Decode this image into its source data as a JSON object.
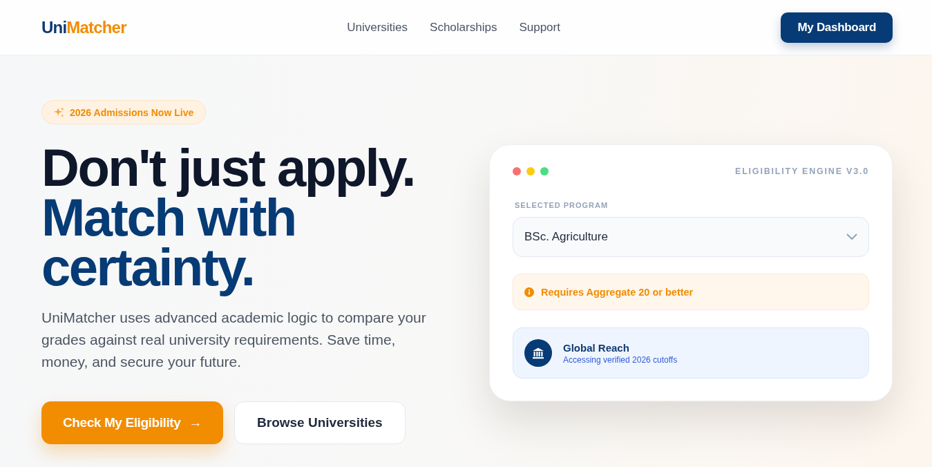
{
  "header": {
    "logo": [
      {
        "text": "Uni",
        "kind": "primary"
      },
      {
        "text": "Matcher",
        "kind": "accent"
      }
    ],
    "nav": [
      {
        "label": "Universities"
      },
      {
        "label": "Scholarships"
      },
      {
        "label": "Support"
      }
    ],
    "dashboard_button": "My Dashboard"
  },
  "hero": {
    "badge": "2026 Admissions Now Live",
    "headline": [
      {
        "text": "Don't just apply.",
        "kind": "dark"
      },
      {
        "text": "Match with certainty.",
        "kind": "brand"
      }
    ],
    "description": "UniMatcher uses advanced academic logic to compare your grades against real university requirements. Save time, money, and secure your future.",
    "buttons": [
      {
        "label": "Check My Eligibility",
        "kind": "primary",
        "arrow": "→"
      },
      {
        "label": "Browse Universities",
        "kind": "secondary"
      }
    ]
  },
  "engine_card": {
    "window_dots": [
      {
        "color": "#f87171"
      },
      {
        "color": "#facc15"
      },
      {
        "color": "#4ade80"
      }
    ],
    "title": "ELIGIBILITY ENGINE V3.0",
    "program_label": "SELECTED PROGRAM",
    "program_select": {
      "value": "BSc. Agriculture"
    },
    "requirement_alert": "Requires Aggregate 20 or better",
    "info_panel": {
      "title": "Global Reach",
      "subtitle": "Accessing verified 2026 cutoffs"
    }
  }
}
